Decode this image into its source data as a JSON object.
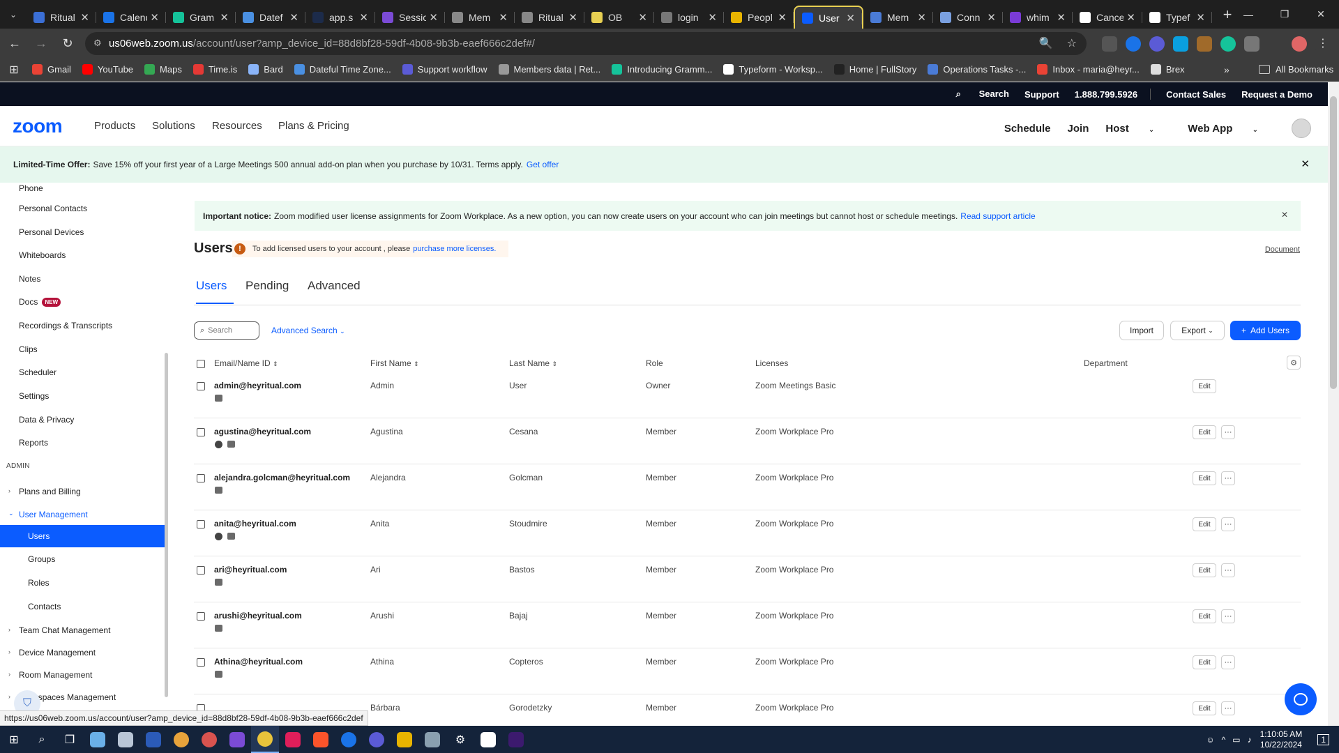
{
  "browser": {
    "tabs": [
      {
        "label": "Ritual",
        "color": "#3b6fd6"
      },
      {
        "label": "Calendar",
        "color": "#1a73e8"
      },
      {
        "label": "Gram",
        "color": "#15c39a"
      },
      {
        "label": "Datef",
        "color": "#4a90e2"
      },
      {
        "label": "app.s",
        "color": "#1c2b4a"
      },
      {
        "label": "Sessio",
        "color": "#7b4bd6"
      },
      {
        "label": "Mem",
        "color": "#888888"
      },
      {
        "label": "Ritual",
        "color": "#888888"
      },
      {
        "label": "OB",
        "color": "#e8d052"
      },
      {
        "label": "login",
        "color": "#777777"
      },
      {
        "label": "Peopl",
        "color": "#e8b400"
      },
      {
        "label": "User",
        "color": "#0b5cff"
      },
      {
        "label": "Mem",
        "color": "#4a7bd6"
      },
      {
        "label": "Conn",
        "color": "#7aa0e0"
      },
      {
        "label": "whim",
        "color": "#7a3bd6"
      },
      {
        "label": "Cance",
        "color": "#ffffff"
      },
      {
        "label": "Typef",
        "color": "#ffffff"
      }
    ],
    "url_host": "us06web.zoom.us",
    "url_path": "/account/user?amp_device_id=88d8bf28-59df-4b08-9b3b-eaef666c2def#/",
    "bookmarks": [
      {
        "label": "Gmail",
        "color": "#ea4335"
      },
      {
        "label": "YouTube",
        "color": "#ff0000"
      },
      {
        "label": "Maps",
        "color": "#34a853"
      },
      {
        "label": "Time.is",
        "color": "#e53935"
      },
      {
        "label": "Bard",
        "color": "#8ab4f8"
      },
      {
        "label": "Dateful Time Zone...",
        "color": "#4a90e2"
      },
      {
        "label": "Support workflow",
        "color": "#5b5bd6"
      },
      {
        "label": "Members data | Ret...",
        "color": "#999999"
      },
      {
        "label": "Introducing Gramm...",
        "color": "#15c39a"
      },
      {
        "label": "Typeform - Worksp...",
        "color": "#ffffff"
      },
      {
        "label": "Home | FullStory",
        "color": "#222222"
      },
      {
        "label": "Operations Tasks -...",
        "color": "#4a7bd6"
      },
      {
        "label": "Inbox - maria@heyr...",
        "color": "#ea4335"
      },
      {
        "label": "Brex",
        "color": "#dddddd"
      }
    ],
    "all_bookmarks": "All Bookmarks",
    "more": "»",
    "status_url": "https://us06web.zoom.us/account/user?amp_device_id=88d8bf28-59df-4b08-9b3b-eaef666c2def"
  },
  "topbar": {
    "search": "Search",
    "support": "Support",
    "phone": "1.888.799.5926",
    "contact_sales": "Contact Sales",
    "request_demo": "Request a Demo"
  },
  "nav": {
    "logo": "zoom",
    "items": [
      "Products",
      "Solutions",
      "Resources",
      "Plans & Pricing"
    ],
    "schedule": "Schedule",
    "join": "Join",
    "host": "Host",
    "web_app": "Web App"
  },
  "promo": {
    "bold": "Limited-Time Offer:",
    "text": "Save 15% off your first year of a Large Meetings 500 annual add-on plan when you purchase by 10/31. Terms apply.",
    "link": "Get offer",
    "close": "✕"
  },
  "sidebar": {
    "items": [
      "Phone",
      "Personal Contacts",
      "Personal Devices",
      "Whiteboards",
      "Notes",
      "Docs",
      "Recordings & Transcripts",
      "Clips",
      "Scheduler",
      "Settings",
      "Data & Privacy",
      "Reports"
    ],
    "docs_badge": "NEW",
    "admin_heading": "ADMIN",
    "admin_items": [
      "Plans and Billing",
      "User Management",
      "Users",
      "Groups",
      "Roles",
      "Contacts",
      "Team Chat Management",
      "Device Management",
      "Room Management",
      "Workspaces Management"
    ]
  },
  "notice": {
    "bold": "Important notice:",
    "text": "Zoom modified user license assignments for Zoom Workplace. As a new option, you can now create users on your account who can join meetings but cannot host or schedule meetings.",
    "link": "Read support article",
    "close": "✕"
  },
  "users": {
    "title": "Users",
    "license_text": "To add licensed users to your account ,  please",
    "license_link": "purchase more licenses.",
    "document": "Document",
    "tabs": [
      "Users",
      "Pending",
      "Advanced"
    ],
    "search_placeholder": "Search",
    "advanced_search": "Advanced Search",
    "import": "Import",
    "export": "Export",
    "add_users": "Add Users",
    "columns": [
      "Email/Name ID",
      "First Name",
      "Last Name",
      "Role",
      "Licenses",
      "Department"
    ],
    "edit_label": "Edit",
    "more_label": "···",
    "rows": [
      {
        "email": "admin@heyritual.com",
        "first": "Admin",
        "last": "User",
        "role": "Owner",
        "license": "Zoom Meetings Basic"
      },
      {
        "email": "agustina@heyritual.com",
        "first": "Agustina",
        "last": "Cesana",
        "role": "Member",
        "license": "Zoom Workplace Pro"
      },
      {
        "email": "alejandra.golcman@heyritual.com",
        "first": "Alejandra",
        "last": "Golcman",
        "role": "Member",
        "license": "Zoom Workplace Pro"
      },
      {
        "email": "anita@heyritual.com",
        "first": "Anita",
        "last": "Stoudmire",
        "role": "Member",
        "license": "Zoom Workplace Pro"
      },
      {
        "email": "ari@heyritual.com",
        "first": "Ari",
        "last": "Bastos",
        "role": "Member",
        "license": "Zoom Workplace Pro"
      },
      {
        "email": "arushi@heyritual.com",
        "first": "Arushi",
        "last": "Bajaj",
        "role": "Member",
        "license": "Zoom Workplace Pro"
      },
      {
        "email": "Athina@heyritual.com",
        "first": "Athina",
        "last": "Copteros",
        "role": "Member",
        "license": "Zoom Workplace Pro"
      },
      {
        "email": "",
        "first": "Bárbara",
        "last": "Gorodetzky",
        "role": "Member",
        "license": "Zoom Workplace Pro"
      }
    ]
  },
  "taskbar": {
    "time": "1:10:05 AM",
    "date": "10/22/2024",
    "notif_count": "1"
  }
}
